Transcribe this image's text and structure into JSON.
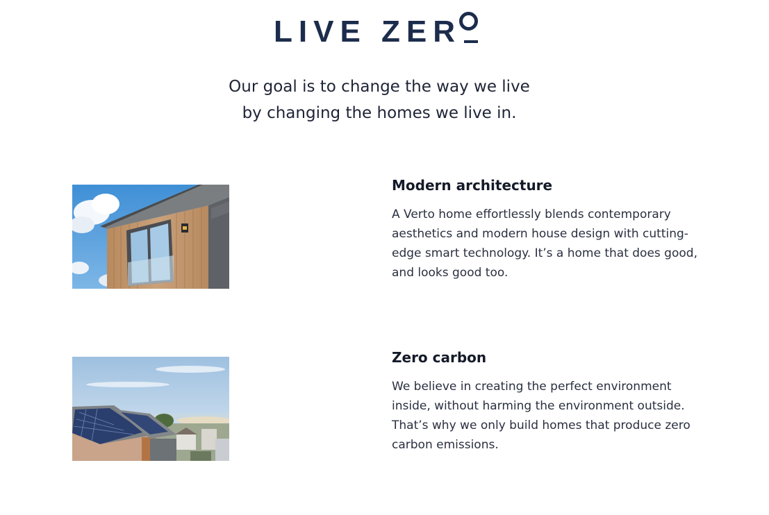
{
  "header": {
    "logo_text": "LIVE ZER",
    "logo_alt": "LIVE ZERO"
  },
  "hero": {
    "tagline_line1": "Our goal is to change the way we live",
    "tagline_line2": "by changing the homes we live in."
  },
  "features": [
    {
      "title": "Modern architecture",
      "description": "A Verto home effortlessly blends contemporary aesthetics and modern house design with cutting-edge smart technology. It’s a home that does good, and looks good too.",
      "image": "timber-clad-house-photo"
    },
    {
      "title": "Zero carbon",
      "description": "We believe in creating the perfect environment inside, without harming the environment outside. That’s why we only build homes that produce zero carbon emissions.",
      "image": "solar-panel-roofs-photo"
    }
  ],
  "colors": {
    "brand_navy": "#1c2c4c",
    "text": "#1e2436",
    "background": "#ffffff"
  }
}
